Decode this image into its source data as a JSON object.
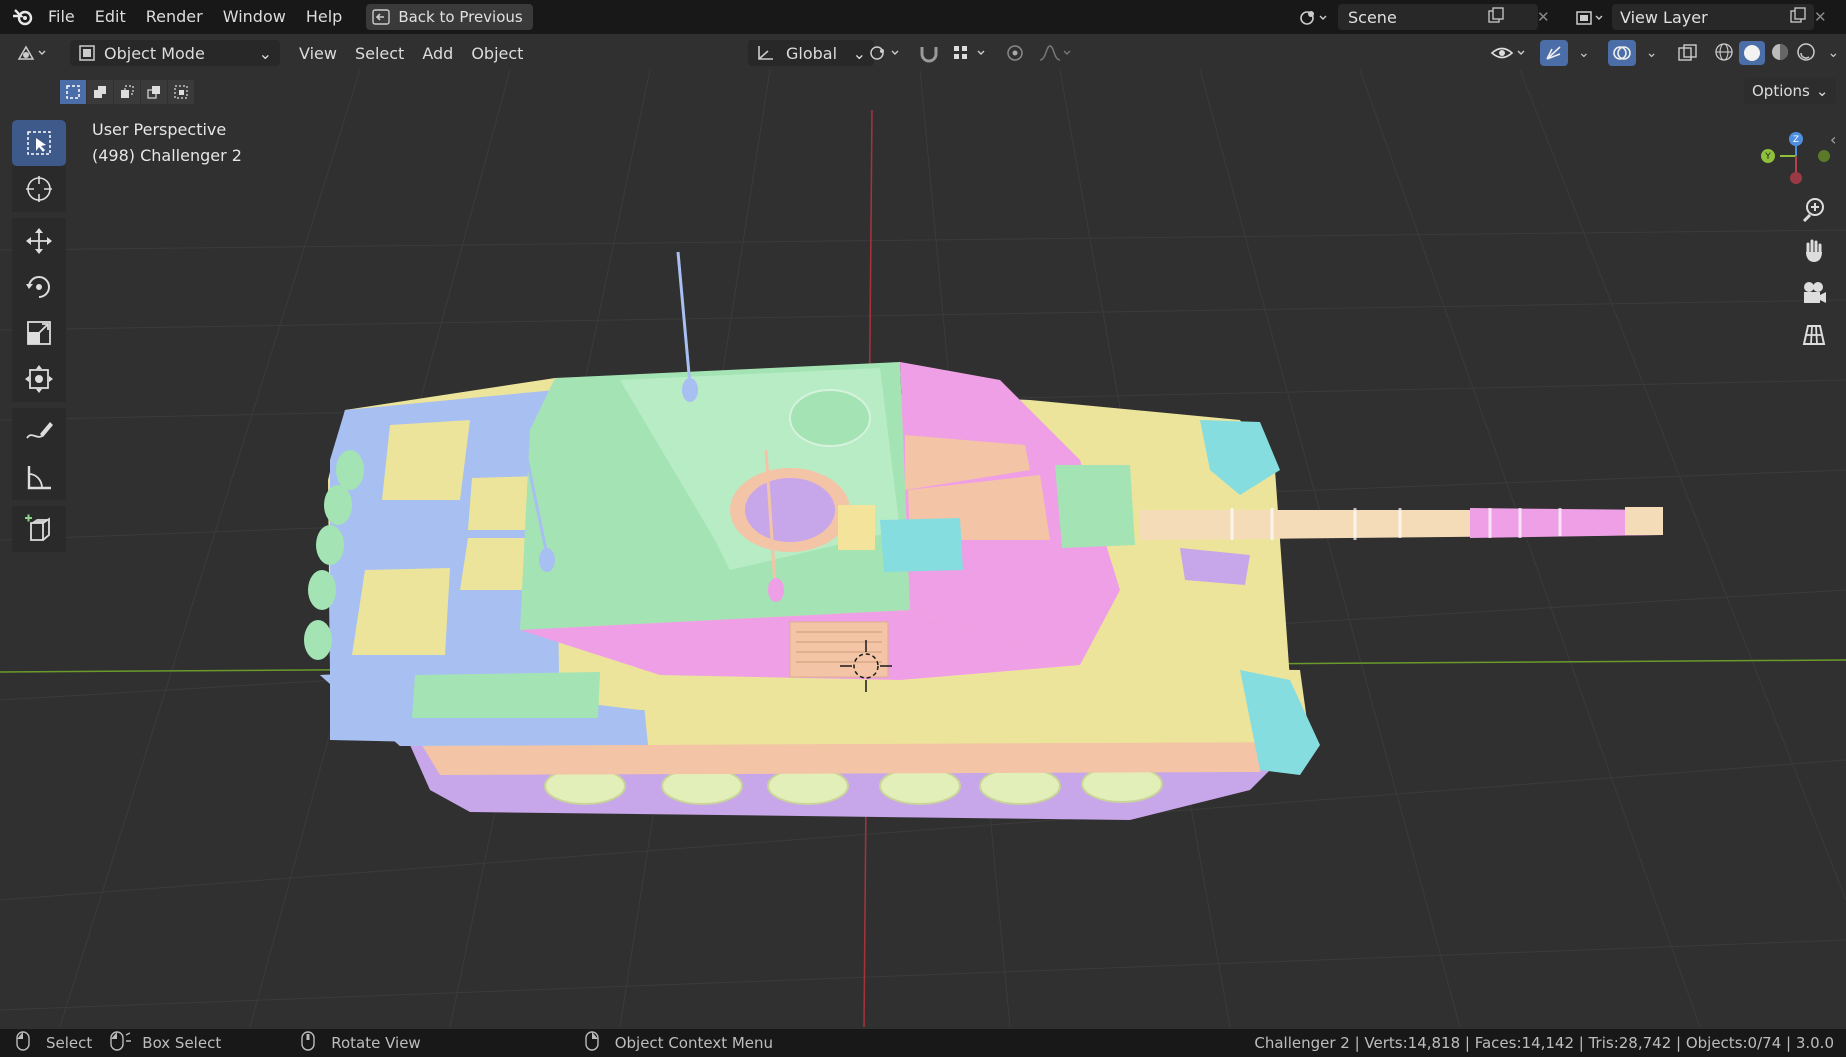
{
  "topbar": {
    "menus": [
      "File",
      "Edit",
      "Render",
      "Window",
      "Help"
    ],
    "back_button": "Back to Previous",
    "scene": "Scene",
    "view_layer": "View Layer"
  },
  "header": {
    "mode": "Object Mode",
    "menus": [
      "View",
      "Select",
      "Add",
      "Object"
    ],
    "transform_orientation": "Global",
    "options": "Options"
  },
  "viewport": {
    "view_name": "User Perspective",
    "object_label": "(498) Challenger 2",
    "colors": {
      "x_axis": "#a8323c",
      "y_axis": "#6a9a2a",
      "grid": "#3a3a3a",
      "bg": "#303030"
    }
  },
  "toolbar": {
    "tools": [
      "select-box-icon",
      "cursor-icon",
      "move-icon",
      "rotate-icon",
      "scale-icon",
      "transform-icon",
      "annotate-icon",
      "measure-icon",
      "add-cube-icon"
    ]
  },
  "statusbar": {
    "select": "Select",
    "box_select": "Box Select",
    "rotate_view": "Rotate View",
    "context_menu": "Object Context Menu",
    "stats": "Challenger 2 | Verts:14,818 | Faces:14,142 | Tris:28,742 | Objects:0/74 | 3.0.0"
  }
}
